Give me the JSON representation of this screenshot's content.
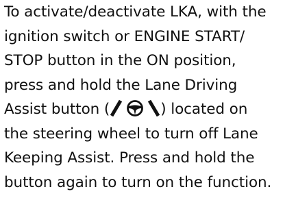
{
  "document": {
    "line_1": "To activate/deactivate LKA, with the",
    "line_2": "ignition switch or ENGINE START/",
    "line_3": "STOP button in the ON position,",
    "line_4": "press and hold the Lane Driving",
    "line_5_before_icon": "Assist button (",
    "line_5_after_icon": ") located on",
    "line_6": "the steering wheel to turn off Lane",
    "line_7": "Keeping Assist. Press and hold the",
    "line_8": "button again to turn on the function."
  },
  "icons": {
    "inline_button_icon": "lane-driving-assist-icon"
  },
  "colors": {
    "text": "#111111",
    "background": "#ffffff"
  }
}
